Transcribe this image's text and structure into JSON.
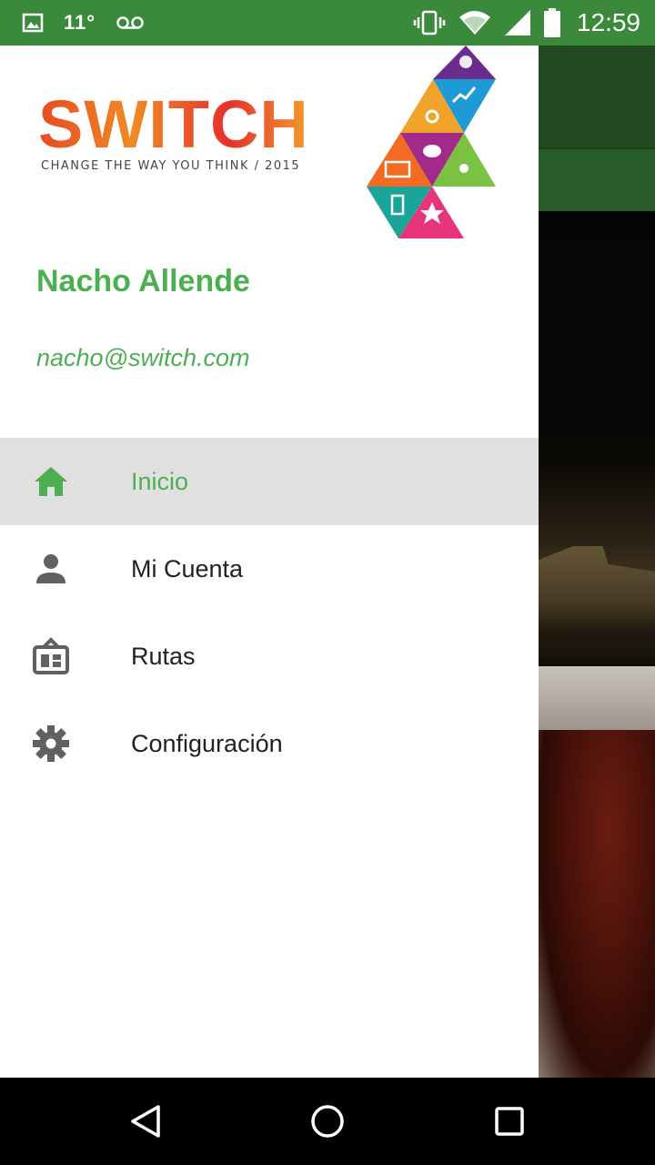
{
  "status_bar": {
    "temperature": "11°",
    "time": "12:59",
    "icons": [
      "image-icon",
      "voicemail-icon",
      "vibrate-icon",
      "wifi-icon",
      "signal-icon",
      "battery-icon"
    ]
  },
  "drawer": {
    "logo": {
      "word": "SWITCH",
      "tagline": "CHANGE THE WAY YOU THINK / 2015"
    },
    "user": {
      "name": "Nacho Allende",
      "email": "nacho@switch.com"
    },
    "menu": [
      {
        "label": "Inicio",
        "icon": "home-icon",
        "active": true
      },
      {
        "label": "Mi Cuenta",
        "icon": "person-icon",
        "active": false
      },
      {
        "label": "Rutas",
        "icon": "routes-icon",
        "active": false
      },
      {
        "label": "Configuración",
        "icon": "gear-icon",
        "active": false
      }
    ]
  },
  "colors": {
    "status_bar": "#3b8a3b",
    "accent": "#4caf50",
    "active_item_bg": "#e0e0e0",
    "icon_gray": "#616161"
  },
  "nav_bar": {
    "icons": [
      "back-icon",
      "home-circle-icon",
      "recents-icon"
    ]
  }
}
